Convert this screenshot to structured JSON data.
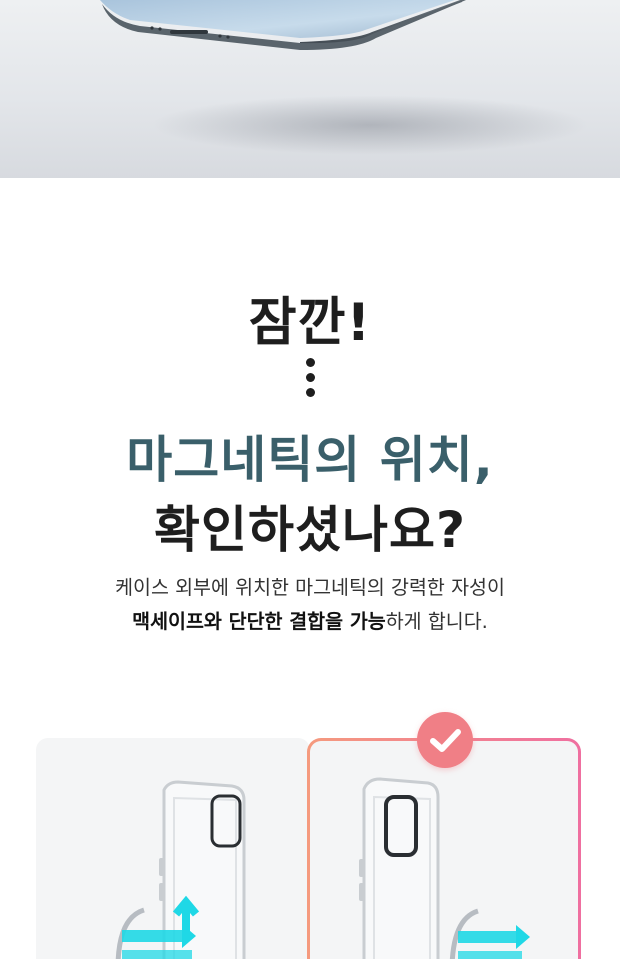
{
  "header": {
    "title_wait": "잠깐!",
    "headline_line1": "마그네틱의 위치,",
    "headline_line2": "확인하셨나요?"
  },
  "description": {
    "line1": "케이스 외부에 위치한 마그네틱의 강력한 자성이",
    "line2_bold_a": "맥세이프와 단단한 결합을 가능",
    "line2_rest": "하게 합니다."
  },
  "comparison": {
    "left_card": {},
    "right_card": {
      "badge": "check-icon"
    }
  },
  "colors": {
    "accent_teal": "#3a5f6a",
    "badge_coral": "#f07f86",
    "arrow_cyan": "#1fd8e6",
    "border_gradient": [
      "#f59a7e",
      "#ef6fa0"
    ]
  }
}
